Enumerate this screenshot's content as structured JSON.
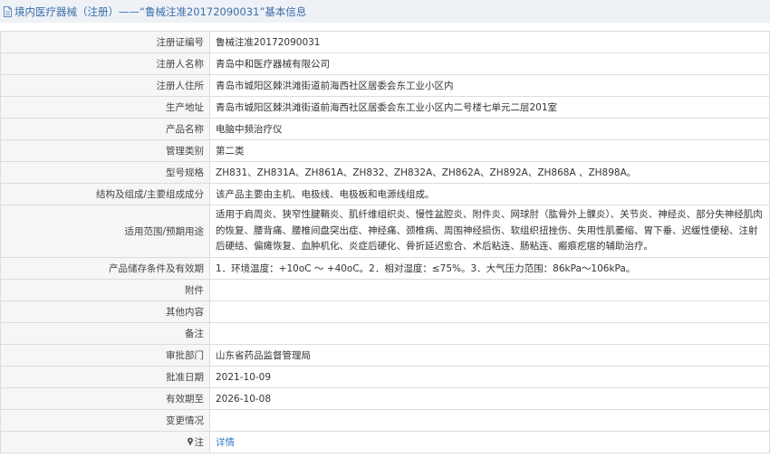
{
  "header": {
    "title": "境内医疗器械（注册）——“鲁械注准20172090031”基本信息",
    "icon": "document-icon"
  },
  "rows": [
    {
      "label": "注册证编号",
      "value": "鲁械注准20172090031"
    },
    {
      "label": "注册人名称",
      "value": "青岛中和医疗器械有限公司"
    },
    {
      "label": "注册人住所",
      "value": "青岛市城阳区棘洪滩街道前海西社区居委会东工业小区内"
    },
    {
      "label": "生产地址",
      "value": "青岛市城阳区棘洪滩街道前海西社区居委会东工业小区内二号楼七单元二层201室"
    },
    {
      "label": "产品名称",
      "value": "电脑中频治疗仪"
    },
    {
      "label": "管理类别",
      "value": "第二类"
    },
    {
      "label": "型号规格",
      "value": "ZH831、ZH831A、ZH861A、ZH832、ZH832A、ZH862A、ZH892A、ZH868A 、ZH898A。"
    },
    {
      "label": "结构及组成/主要组成成分",
      "value": "该产品主要由主机、电极线、电极板和电源线组成。"
    },
    {
      "label": "适用范围/预期用途",
      "value": "适用于肩周炎、狭窄性腱鞘炎、肌纤维组织炎、慢性盆腔炎、附件炎、网球肘（肱骨外上髁炎）、关节炎、神经炎、部分失神经肌肉的恢复、腰背痛、腰椎间盘突出症、神经痛、颈椎病、周围神经损伤、软组织扭挫伤、失用性肌萎缩、胃下垂、迟缓性便秘、注射后硬结、偏瘫恢复、血肿机化、炎症后硬化、骨折延迟愈合、术后粘连、肠粘连、瘢痕疙瘩的辅助治疗。"
    },
    {
      "label": "产品储存条件及有效期",
      "value": "1．环境温度：+10oC ～ +40oC。2．相对湿度：≤75%。3．大气压力范围：86kPa～106kPa。"
    },
    {
      "label": "附件",
      "value": ""
    },
    {
      "label": "其他内容",
      "value": ""
    },
    {
      "label": "备注",
      "value": ""
    },
    {
      "label": "审批部门",
      "value": "山东省药品监督管理局"
    },
    {
      "label": "批准日期",
      "value": "2021-10-09"
    },
    {
      "label": "有效期至",
      "value": "2026-10-08"
    },
    {
      "label": "变更情况",
      "value": ""
    }
  ],
  "note_row": {
    "label": "注",
    "icon": "pin-icon",
    "link_text": "详情"
  },
  "colors": {
    "title_text": "#3a6fa8",
    "title_bg": "#eef1f6",
    "label_bg": "#f6f6f6",
    "border": "#dcdcdc",
    "link": "#3a7ec8"
  }
}
